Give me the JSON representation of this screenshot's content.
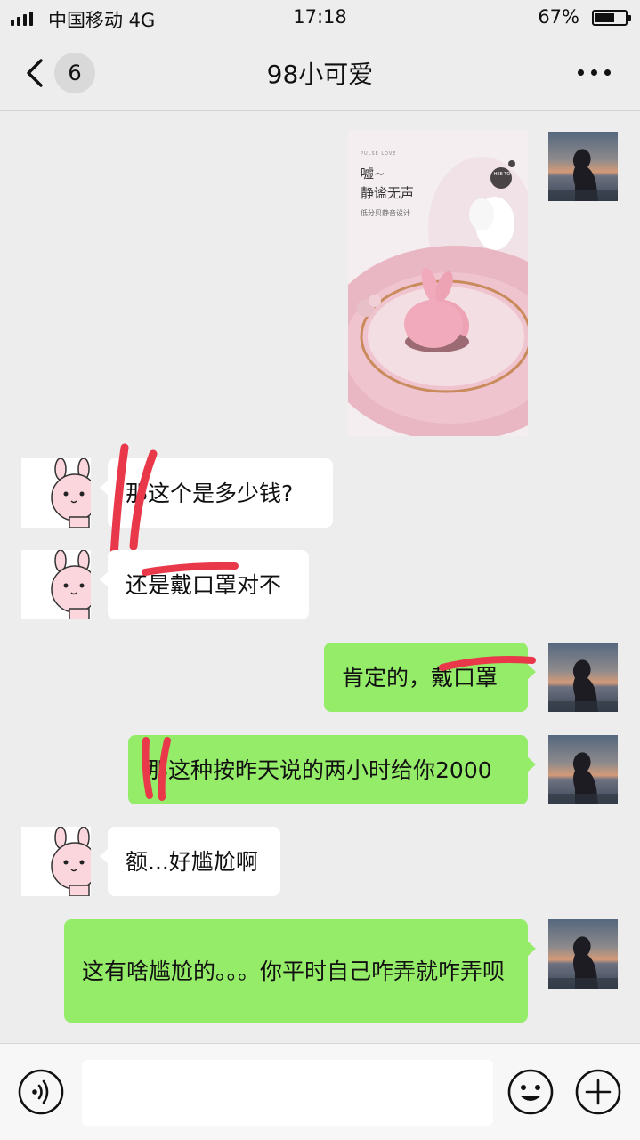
{
  "status_bar": {
    "carrier": "中国移动  4G",
    "time": "17:18",
    "battery": "67%",
    "battery_level": 0.67
  },
  "nav": {
    "unread_count": "6",
    "title": "98小可爱"
  },
  "messages": [
    {
      "from": "me",
      "type": "image",
      "image_text": [
        "嘘~",
        "静谧无声",
        "低分贝静音设计"
      ],
      "brand": "PULSE LOVE",
      "badge": "HEE TO"
    },
    {
      "from": "them",
      "text": "那这个是多少钱?"
    },
    {
      "from": "them",
      "text": "还是戴口罩对不"
    },
    {
      "from": "me",
      "text": "肯定的，戴口罩"
    },
    {
      "from": "me",
      "text": "那这种按昨天说的两小时给你2000"
    },
    {
      "from": "them",
      "text": "额...好尴尬啊"
    },
    {
      "from": "me",
      "text": "这有啥尴尬的。。。你平时自己咋弄就咋弄呗"
    }
  ],
  "colors": {
    "background": "#ededed",
    "sent_bubble": "#95ec69",
    "received_bubble": "#ffffff",
    "scribble": "#e8384a"
  },
  "icons": {
    "back": "back-chevron-icon",
    "more": "more-dots-icon",
    "voice": "voice-icon",
    "emoji": "emoji-icon",
    "plus": "plus-icon"
  }
}
